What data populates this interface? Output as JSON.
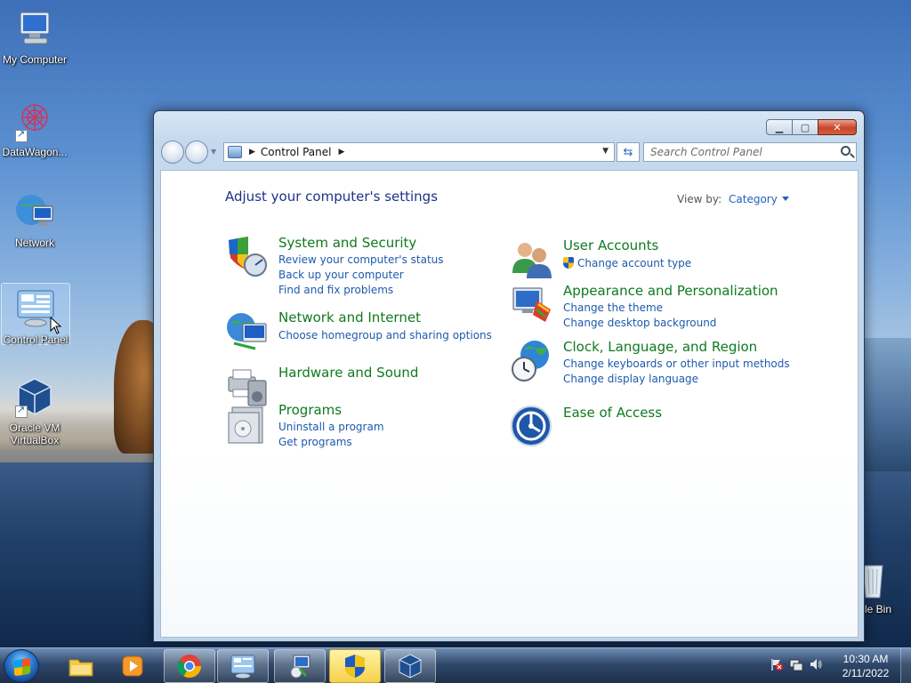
{
  "desktop": {
    "icons": [
      {
        "label": "My Computer",
        "icon": "computer-icon"
      },
      {
        "label": "DataWagon...",
        "icon": "datawagon-icon"
      },
      {
        "label": "Network",
        "icon": "network-icon"
      },
      {
        "label": "Control Panel",
        "icon": "control-panel-icon"
      },
      {
        "label": "Oracle VM VirtualBox",
        "icon": "virtualbox-icon"
      },
      {
        "label": "cle Bin",
        "icon": "recycle-bin-icon"
      }
    ]
  },
  "window": {
    "breadcrumb": "Control Panel",
    "search_placeholder": "Search Control Panel",
    "heading": "Adjust your computer's settings",
    "view_by_label": "View by:",
    "view_by_value": "Category",
    "categories": [
      {
        "title": "System and Security",
        "icon": "security-shield-icon",
        "links": [
          "Review your computer's status",
          "Back up your computer",
          "Find and fix problems"
        ]
      },
      {
        "title": "Network and Internet",
        "icon": "network-globe-icon",
        "links": [
          "Choose homegroup and sharing options"
        ]
      },
      {
        "title": "Hardware and Sound",
        "icon": "printer-speaker-icon",
        "links": []
      },
      {
        "title": "Programs",
        "icon": "programs-icon",
        "links": [
          "Uninstall a program",
          "Get programs"
        ]
      },
      {
        "title": "User Accounts",
        "icon": "users-icon",
        "links": [
          "Change account type"
        ]
      },
      {
        "title": "Appearance and Personalization",
        "icon": "appearance-icon",
        "links": [
          "Change the theme",
          "Change desktop background"
        ]
      },
      {
        "title": "Clock, Language, and Region",
        "icon": "clock-globe-icon",
        "links": [
          "Change keyboards or other input methods",
          "Change display language"
        ]
      },
      {
        "title": "Ease of Access",
        "icon": "ease-of-access-icon",
        "links": []
      }
    ]
  },
  "taskbar": {
    "time": "10:30 AM",
    "date": "2/11/2022",
    "pinned": [
      "explorer-icon",
      "media-player-icon",
      "chrome-icon",
      "control-panel-icon",
      "installer-icon",
      "uac-shield-icon",
      "virtualbox-icon"
    ]
  },
  "colors": {
    "category_title": "#0e7a1f",
    "link": "#1d5aac",
    "heading": "#1e3287"
  }
}
